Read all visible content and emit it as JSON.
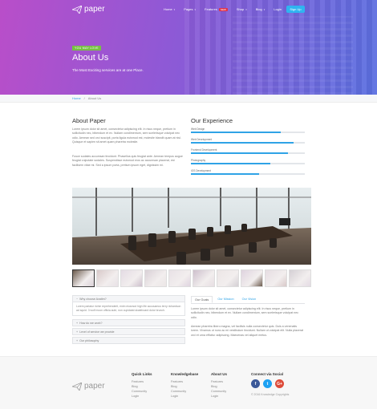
{
  "nav": {
    "logo": "paper",
    "items": [
      {
        "label": "Home",
        "caret": true
      },
      {
        "label": "Pages",
        "caret": true
      },
      {
        "label": "Features",
        "caret": false,
        "badge": "NEW"
      },
      {
        "label": "Shop",
        "caret": true
      },
      {
        "label": "Blog",
        "caret": true
      },
      {
        "label": "Login",
        "caret": false
      }
    ],
    "signup": "Sign Up"
  },
  "hero": {
    "tag": "YOU MAY LOVE",
    "title": "About Us",
    "subtitle": "The Most Exciting services are at one Place."
  },
  "breadcrumb": {
    "home": "Home",
    "separator": "/",
    "current": "About Us"
  },
  "about": {
    "title": "About Paper",
    "paragraphs": [
      "Lorem ipsum dolor sit amet, consectetur adipiscing elit. In risus neque, pretium in sollicitudin nec, bibendum et ex. Nullam condimentum, sem scelerisque volutpat nec odio. Aenean sed orci suscipit, porta ligula euismod est, molestie blandit quam at nisl. Quisque et sapien sit amet quam pharetra molestie.",
      "Fusce sodales accumsan tincidunt. Phasellus quis feugiat ante. Aenean tempus augue feugiat vulputate sodales. Suspendisse euismod eros ac accumsan placerat, est facilisem vitae mi. Sed a ipsum porta, pretium ipsum eget, dignissim mi."
    ]
  },
  "experience": {
    "title": "Our Experience",
    "skills": [
      {
        "label": "Web Design",
        "level": 0.79
      },
      {
        "label": "Web Development",
        "level": 0.9
      },
      {
        "label": "Frontend Development",
        "level": 0.85
      },
      {
        "label": "Photography",
        "level": 0.7
      },
      {
        "label": "iOS Development",
        "level": 0.6
      }
    ]
  },
  "accordion": {
    "items": [
      {
        "label": "Why choose Avatim?",
        "open": true,
        "body": "Lorem pariatur richie reprehenderit, enim eiusmod high life accusamus terry richardson ad squid. 3 wolf moon officia aute, non cupidatat skateboard dolor brunch."
      },
      {
        "label": "How do we work?",
        "open": false
      },
      {
        "label": "Level of service we provide",
        "open": false
      },
      {
        "label": "Our philosophy",
        "open": false
      }
    ]
  },
  "tabs": {
    "items": [
      "Our Goals",
      "Our Mission",
      "Our Vision"
    ],
    "active": 0,
    "paragraphs": [
      "Lorem ipsum dolor sit amet, consectetur adipiscing elit. In risus neque, pretium in sollicitudin nec, bibendum et ex. Nullam condimentum, sem scelerisque volutpat nec odio.",
      "Aenean pharetra libero magna, vel facilisis nulla consectetur quis. Duis a venenatis lorem. Vivamus ut nunc ac mi vestibulum tincidunt. Nullam ut volutpat elit. Nulla placerat orci et urna efficitur adipiscing. Maecenas vel aliquet metus."
    ]
  },
  "footer": {
    "logo": "paper",
    "columns": [
      {
        "title": "Quick Links",
        "links": [
          "Features",
          "Blog",
          "Community",
          "Login"
        ]
      },
      {
        "title": "Knowledgebase",
        "links": [
          "Features",
          "Blog",
          "Community",
          "Login"
        ]
      },
      {
        "title": "About Us",
        "links": [
          "Features",
          "Blog",
          "Community",
          "Login"
        ]
      }
    ],
    "connect": {
      "title": "Connect via Social",
      "icons": [
        {
          "name": "facebook-icon",
          "glyph": "f",
          "color": "#3b5998"
        },
        {
          "name": "twitter-icon",
          "glyph": "t",
          "color": "#1da1f2"
        },
        {
          "name": "google-plus-icon",
          "glyph": "G+",
          "color": "#dd4b39"
        }
      ],
      "copyright": "© 2016 Knowledge Copyrights"
    }
  },
  "colors": {
    "accent": "#2fa3e6",
    "signup": "#2fb4f0",
    "tag": "#76c043",
    "badge": "#e0334b"
  }
}
